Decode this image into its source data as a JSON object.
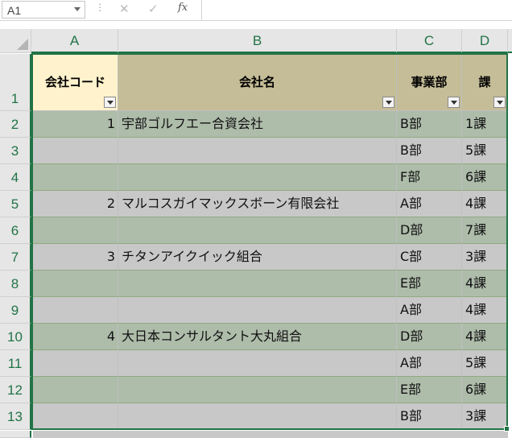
{
  "formula_bar": {
    "name_box": "A1",
    "fx_label": "fx",
    "cancel_icon": "✕",
    "enter_icon": "✓",
    "dots": "⋮",
    "formula": ""
  },
  "columns": [
    "A",
    "B",
    "C",
    "D"
  ],
  "row_numbers": [
    "1",
    "2",
    "3",
    "4",
    "5",
    "6",
    "7",
    "8",
    "9",
    "10",
    "11",
    "12",
    "13"
  ],
  "header": {
    "company_code": "会社コード",
    "company_name": "会社名",
    "division": "事業部",
    "section": "課"
  },
  "rows": [
    {
      "code": "1",
      "name": "宇部ゴルフエー合資会社",
      "division": "B部",
      "section": "1課"
    },
    {
      "code": "",
      "name": "",
      "division": "B部",
      "section": "5課"
    },
    {
      "code": "",
      "name": "",
      "division": "F部",
      "section": "6課"
    },
    {
      "code": "2",
      "name": "マルコスガイマックスボーン有限会社",
      "division": "A部",
      "section": "4課"
    },
    {
      "code": "",
      "name": "",
      "division": "D部",
      "section": "7課"
    },
    {
      "code": "3",
      "name": "チタンアイクイック組合",
      "division": "C部",
      "section": "3課"
    },
    {
      "code": "",
      "name": "",
      "division": "E部",
      "section": "4課"
    },
    {
      "code": "",
      "name": "",
      "division": "A部",
      "section": "4課"
    },
    {
      "code": "4",
      "name": "大日本コンサルタント大丸組合",
      "division": "D部",
      "section": "4課"
    },
    {
      "code": "",
      "name": "",
      "division": "A部",
      "section": "5課"
    },
    {
      "code": "",
      "name": "",
      "division": "E部",
      "section": "6課"
    },
    {
      "code": "",
      "name": "",
      "division": "B部",
      "section": "3課"
    }
  ],
  "colors": {
    "header_code_fill": "#fff2cc",
    "header_fill": "#c4bd97",
    "band_green": "#aebcaa",
    "band_gray": "#c8c8c8",
    "excel_green": "#217346"
  }
}
